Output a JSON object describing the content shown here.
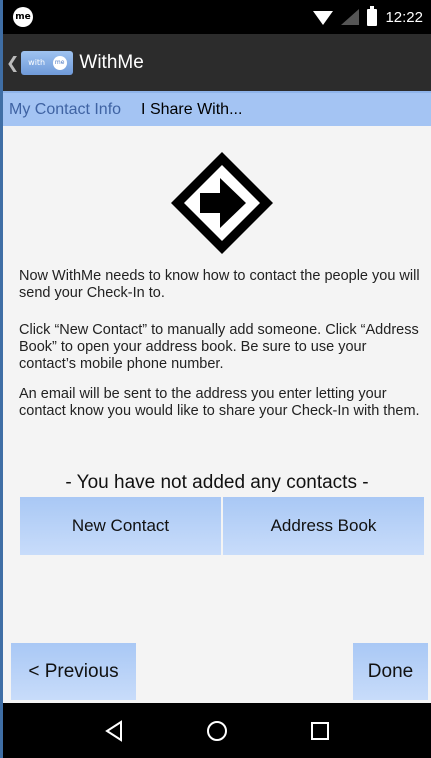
{
  "status_bar": {
    "app_badge": "me",
    "time": "12:22"
  },
  "app_bar": {
    "logo_text_left": "with",
    "logo_text_right": "me",
    "title": "WithMe"
  },
  "tabs": [
    {
      "label": "My Contact Info",
      "active": false
    },
    {
      "label": "I Share With...",
      "active": true
    }
  ],
  "content": {
    "paragraph_1": "Now WithMe needs to know how to contact the people you will send your Check-In to.",
    "paragraph_2": "Click “New Contact” to manually add someone. Click “Address Book” to open your address book. Be sure to use your contact’s mobile phone number.",
    "paragraph_3": "An email will be sent to the address you enter letting your contact know you would like to share your Check-In with them.",
    "empty_message": "- You have not added any contacts -"
  },
  "buttons": {
    "new_contact": "New Contact",
    "address_book": "Address Book",
    "previous": "< Previous",
    "done": "Done"
  },
  "colors": {
    "tab_bar": "#a4c4f3",
    "button": "#b8d3f7",
    "app_bar": "#2c2c2c"
  }
}
